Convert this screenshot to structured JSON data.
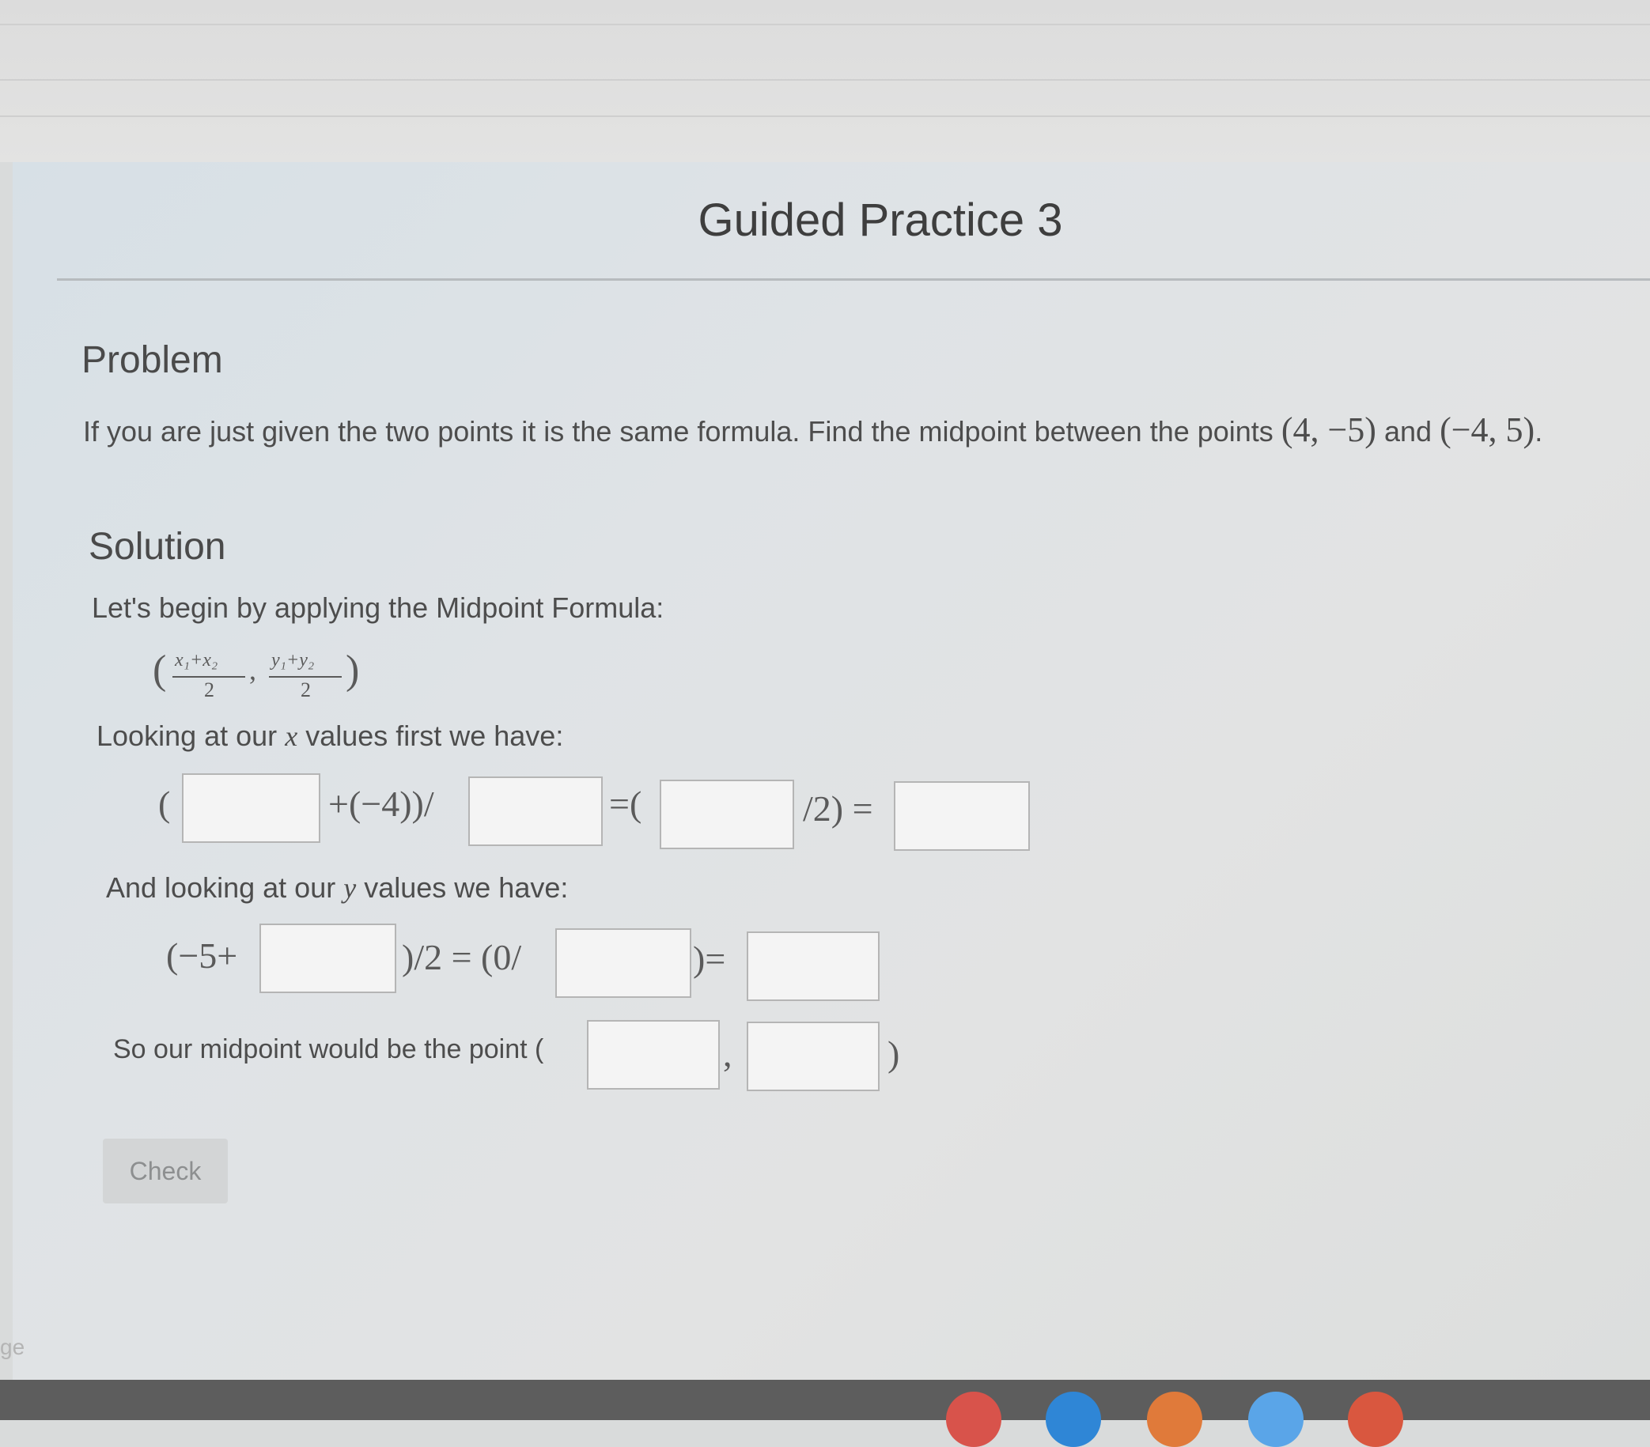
{
  "header": {
    "title": "Guided Practice 3"
  },
  "problem": {
    "heading": "Problem",
    "text": "If you are just given the two points it is the same formula. Find the midpoint between the points",
    "point1": "(4, −5)",
    "and": "and",
    "point2": "(−4, 5)",
    "end": "."
  },
  "solution": {
    "heading": "Solution",
    "intro": "Let's begin by applying the Midpoint Formula:",
    "formula": {
      "open": "(",
      "x_num": "x₁+x₂",
      "x_den": "2",
      "comma": ",",
      "y_num": "y₁+y₂",
      "y_den": "2",
      "close": ")"
    },
    "x_intro_pre": "Looking at our",
    "x_var": "x",
    "x_intro_post": "values first we have:",
    "x_eq": {
      "open": "(",
      "plus_neg4": "+(−4))/",
      "eq_open": "=(",
      "over2": "/2) ="
    },
    "y_intro_pre": "And looking at our",
    "y_var": "y",
    "y_intro_post": "values we have:",
    "y_eq": {
      "start": "(−5+",
      "half": ")/2 = (0/",
      "close_eq": ")="
    },
    "conclusion": "So our midpoint would be the point (",
    "point_comma": ",",
    "point_close": ")"
  },
  "inputs": {
    "x1": "",
    "x_den": "",
    "x_sum": "",
    "x_result": "",
    "y2": "",
    "y_den": "",
    "y_result": "",
    "mid_x": "",
    "mid_y": ""
  },
  "buttons": {
    "check": "Check"
  },
  "footer": {
    "corner_label": "ge"
  },
  "taskbar_icons": [
    "red-app-icon",
    "blue-app-icon",
    "orange-app-icon",
    "light-blue-app-icon",
    "red-orange-app-icon"
  ]
}
